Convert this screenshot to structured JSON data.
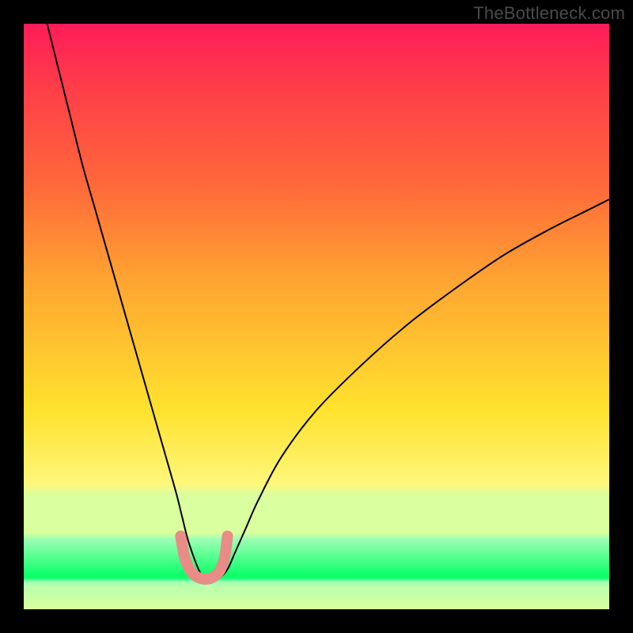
{
  "watermark": "TheBottleneck.com",
  "chart_data": {
    "type": "line",
    "title": "",
    "xlabel": "",
    "ylabel": "",
    "xlim": [
      0,
      100
    ],
    "ylim": [
      0,
      100
    ],
    "grid": false,
    "legend": false,
    "series": [
      {
        "name": "left-curve",
        "stroke": "#000000",
        "x": [
          4,
          6,
          8,
          10,
          12,
          14,
          16,
          18,
          20,
          22,
          24,
          26,
          27,
          28,
          29,
          30,
          31,
          32,
          33
        ],
        "values": [
          100,
          92,
          84,
          76,
          69,
          62,
          55,
          48,
          41,
          34,
          27,
          20,
          16,
          12,
          9,
          6.5,
          5,
          4.5,
          5.2
        ]
      },
      {
        "name": "right-curve",
        "stroke": "#000000",
        "x": [
          33,
          34,
          35,
          36,
          38,
          40,
          44,
          50,
          58,
          66,
          74,
          82,
          90,
          96,
          100
        ],
        "values": [
          5.2,
          5.8,
          7.2,
          9.5,
          14,
          18.5,
          26,
          34,
          42,
          49,
          55,
          60.5,
          65,
          68,
          70
        ]
      },
      {
        "name": "salmon-well",
        "stroke": "#e98b86",
        "stroke_width_px": 14,
        "x": [
          26.8,
          27.5,
          28.5,
          29.5,
          30.5,
          31.5,
          32.5,
          33.5,
          34.3,
          34.8
        ],
        "values": [
          12.5,
          8.8,
          6.6,
          5.6,
          5.2,
          5.2,
          5.6,
          6.6,
          8.8,
          12.5
        ]
      }
    ],
    "notes": "Axes have no visible tick labels; values estimated on a 0–100 normalized scale from pixel positions."
  }
}
